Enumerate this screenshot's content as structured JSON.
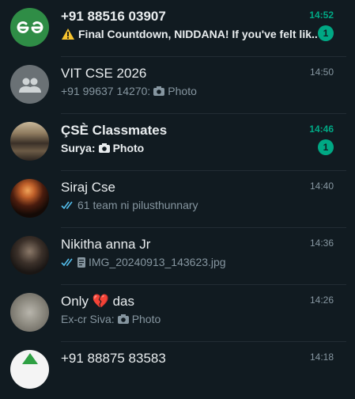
{
  "colors": {
    "background": "#111b21",
    "accent": "#00a884",
    "text": "#e9edef",
    "muted": "#8696a0",
    "tick": "#53bdeb"
  },
  "chats": [
    {
      "name": "+91 88516 03907",
      "time": "14:52",
      "preview": "Final Countdown, NIDDANA! If you've felt lik...",
      "unread": "1",
      "avatar": "geeksforgeeks-logo",
      "prefix_icon": "warning-icon"
    },
    {
      "name": "VIT CSE 2026",
      "time": "14:50",
      "sender": "+91 99637 14270:",
      "preview": "Photo",
      "avatar": "group-icon",
      "prefix_icon": "camera-icon"
    },
    {
      "name": "ÇSÈ Classmates",
      "time": "14:46",
      "sender": "Surya:",
      "preview": "Photo",
      "unread": "1",
      "avatar": "group-photo",
      "prefix_icon": "camera-icon"
    },
    {
      "name": "Siraj Cse",
      "time": "14:40",
      "preview": "61 team ni pilusthunnary",
      "avatar": "person-photo",
      "prefix_icon": "double-check-icon"
    },
    {
      "name": "Nikitha anna Jr",
      "time": "14:36",
      "preview": "IMG_20240913_143623.jpg",
      "avatar": "person-photo",
      "prefix_icon": "double-check-icon"
    },
    {
      "name": "Only 💔 das",
      "time": "14:26",
      "sender": "Ex-cr Siva:",
      "preview": "Photo",
      "avatar": "person-photo",
      "prefix_icon": "camera-icon"
    },
    {
      "name": "+91 88875 83583",
      "time": "14:18",
      "avatar": "app-logo"
    }
  ]
}
